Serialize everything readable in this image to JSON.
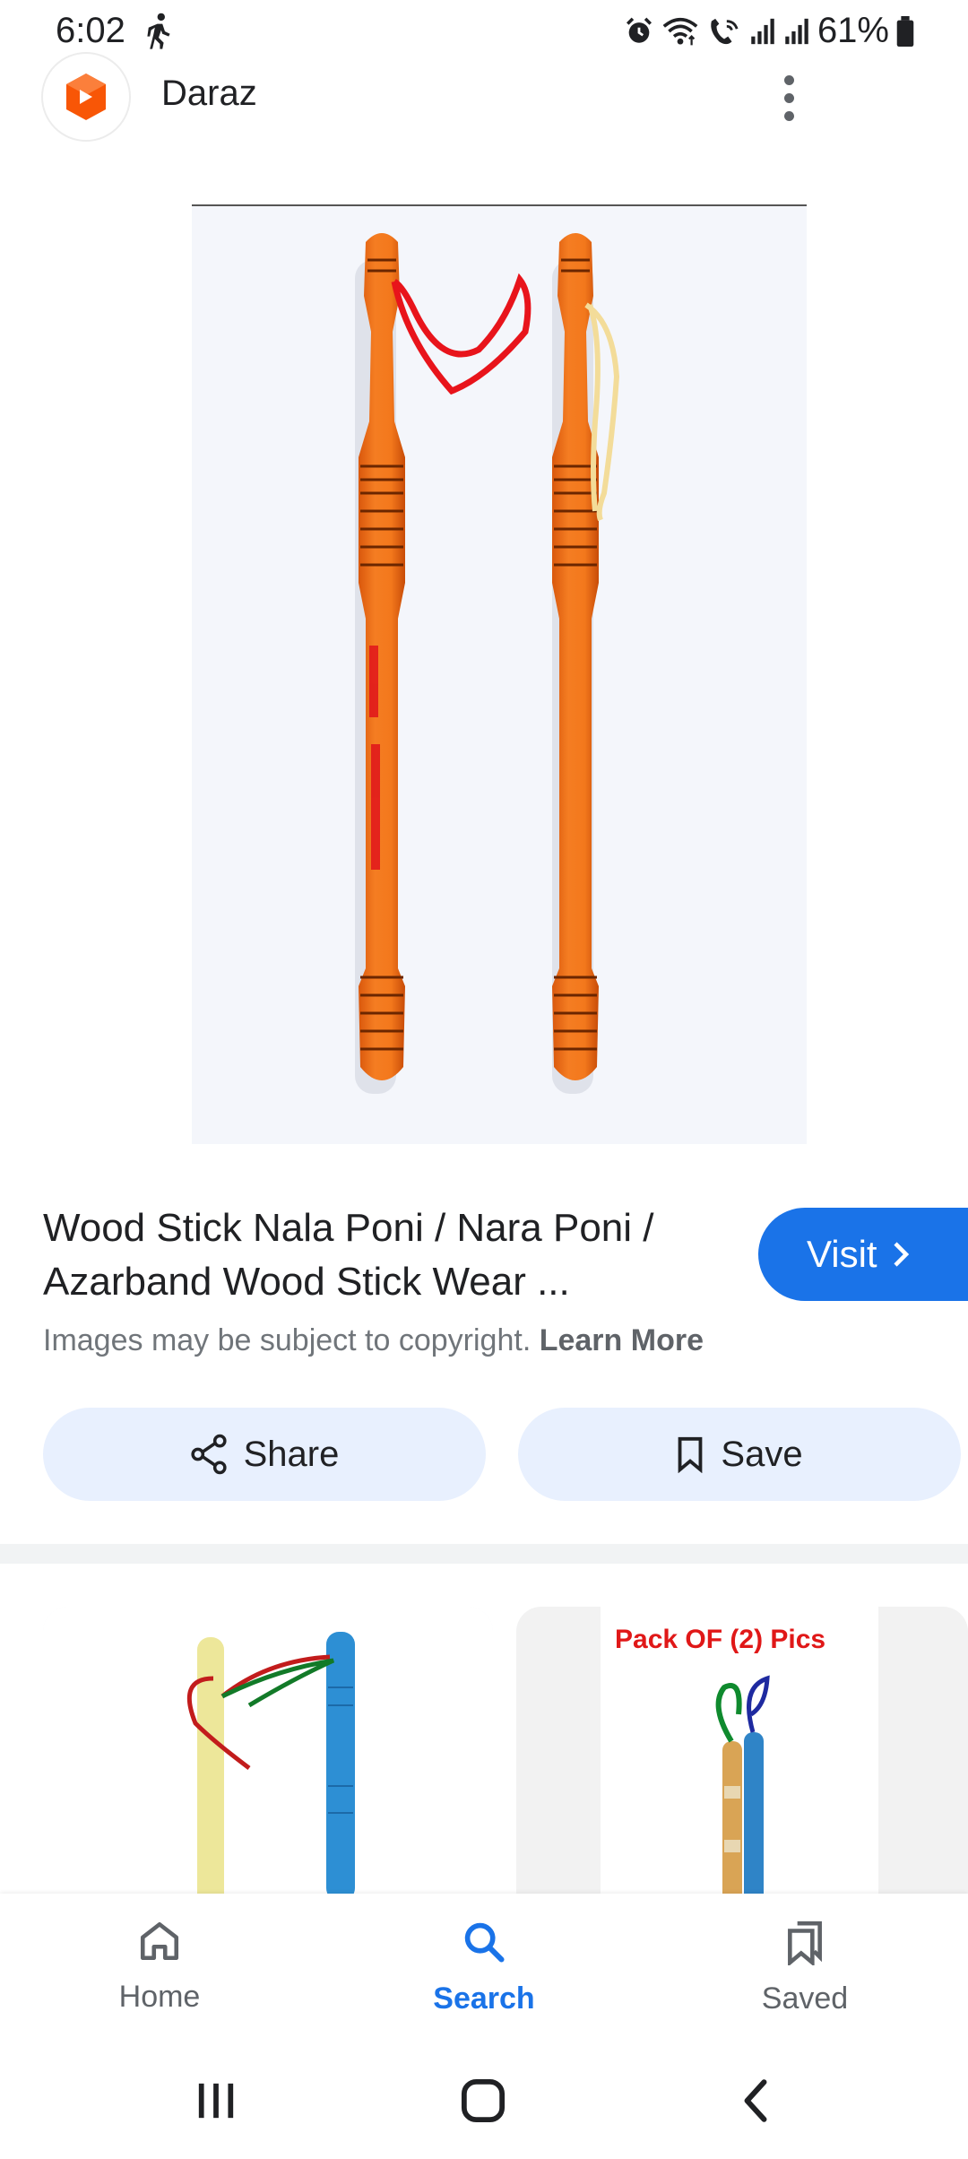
{
  "status_bar": {
    "time": "6:02",
    "battery": "61%",
    "icons": [
      "walking-icon",
      "alarm-icon",
      "wifi-icon",
      "wifi-calling-icon",
      "signal-icon",
      "signal-icon",
      "battery-icon"
    ]
  },
  "header": {
    "app_name": "Daraz",
    "logo_icon": "daraz-logo-icon",
    "more_icon": "more-vert-icon"
  },
  "result": {
    "title_line1": "Wood Stick Nala Poni / Nara Poni /",
    "title_line2": "Azarband Wood Stick Wear ...",
    "visit_label": "Visit",
    "copyright_text": "Images may be subject to copyright.",
    "learn_more": "Learn More"
  },
  "actions": {
    "share_label": "Share",
    "save_label": "Save"
  },
  "related": {
    "card2_banner": "Pack OF (2) Pics"
  },
  "bottom_nav": {
    "items": [
      {
        "label": "Home",
        "icon": "home-icon"
      },
      {
        "label": "Search",
        "icon": "search-icon"
      },
      {
        "label": "Saved",
        "icon": "bookmarks-icon"
      }
    ],
    "active": "Search"
  },
  "colors": {
    "accent": "#1a73e8",
    "button_bg": "#e8f0fe",
    "daraz_orange": "#f85606"
  }
}
